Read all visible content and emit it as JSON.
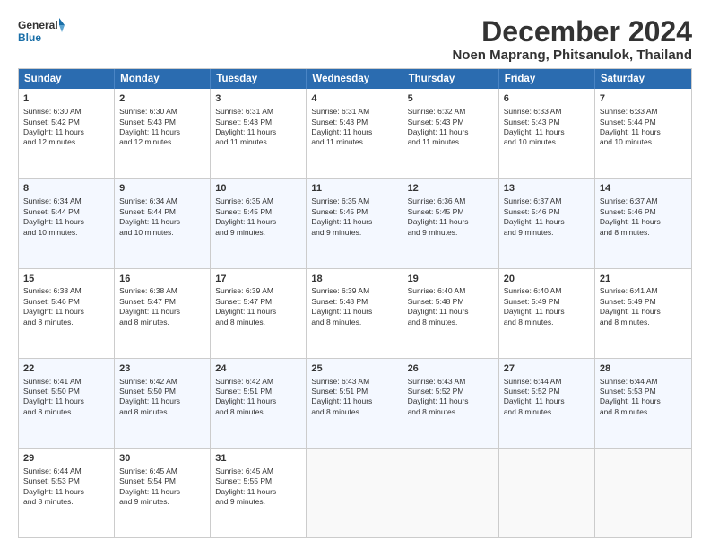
{
  "logo": {
    "line1": "General",
    "line2": "Blue"
  },
  "title": "December 2024",
  "subtitle": "Noen Maprang, Phitsanulok, Thailand",
  "days": [
    "Sunday",
    "Monday",
    "Tuesday",
    "Wednesday",
    "Thursday",
    "Friday",
    "Saturday"
  ],
  "weeks": [
    [
      {
        "num": "1",
        "lines": [
          "Sunrise: 6:30 AM",
          "Sunset: 5:42 PM",
          "Daylight: 11 hours",
          "and 12 minutes."
        ]
      },
      {
        "num": "2",
        "lines": [
          "Sunrise: 6:30 AM",
          "Sunset: 5:43 PM",
          "Daylight: 11 hours",
          "and 12 minutes."
        ]
      },
      {
        "num": "3",
        "lines": [
          "Sunrise: 6:31 AM",
          "Sunset: 5:43 PM",
          "Daylight: 11 hours",
          "and 11 minutes."
        ]
      },
      {
        "num": "4",
        "lines": [
          "Sunrise: 6:31 AM",
          "Sunset: 5:43 PM",
          "Daylight: 11 hours",
          "and 11 minutes."
        ]
      },
      {
        "num": "5",
        "lines": [
          "Sunrise: 6:32 AM",
          "Sunset: 5:43 PM",
          "Daylight: 11 hours",
          "and 11 minutes."
        ]
      },
      {
        "num": "6",
        "lines": [
          "Sunrise: 6:33 AM",
          "Sunset: 5:43 PM",
          "Daylight: 11 hours",
          "and 10 minutes."
        ]
      },
      {
        "num": "7",
        "lines": [
          "Sunrise: 6:33 AM",
          "Sunset: 5:44 PM",
          "Daylight: 11 hours",
          "and 10 minutes."
        ]
      }
    ],
    [
      {
        "num": "8",
        "lines": [
          "Sunrise: 6:34 AM",
          "Sunset: 5:44 PM",
          "Daylight: 11 hours",
          "and 10 minutes."
        ]
      },
      {
        "num": "9",
        "lines": [
          "Sunrise: 6:34 AM",
          "Sunset: 5:44 PM",
          "Daylight: 11 hours",
          "and 10 minutes."
        ]
      },
      {
        "num": "10",
        "lines": [
          "Sunrise: 6:35 AM",
          "Sunset: 5:45 PM",
          "Daylight: 11 hours",
          "and 9 minutes."
        ]
      },
      {
        "num": "11",
        "lines": [
          "Sunrise: 6:35 AM",
          "Sunset: 5:45 PM",
          "Daylight: 11 hours",
          "and 9 minutes."
        ]
      },
      {
        "num": "12",
        "lines": [
          "Sunrise: 6:36 AM",
          "Sunset: 5:45 PM",
          "Daylight: 11 hours",
          "and 9 minutes."
        ]
      },
      {
        "num": "13",
        "lines": [
          "Sunrise: 6:37 AM",
          "Sunset: 5:46 PM",
          "Daylight: 11 hours",
          "and 9 minutes."
        ]
      },
      {
        "num": "14",
        "lines": [
          "Sunrise: 6:37 AM",
          "Sunset: 5:46 PM",
          "Daylight: 11 hours",
          "and 8 minutes."
        ]
      }
    ],
    [
      {
        "num": "15",
        "lines": [
          "Sunrise: 6:38 AM",
          "Sunset: 5:46 PM",
          "Daylight: 11 hours",
          "and 8 minutes."
        ]
      },
      {
        "num": "16",
        "lines": [
          "Sunrise: 6:38 AM",
          "Sunset: 5:47 PM",
          "Daylight: 11 hours",
          "and 8 minutes."
        ]
      },
      {
        "num": "17",
        "lines": [
          "Sunrise: 6:39 AM",
          "Sunset: 5:47 PM",
          "Daylight: 11 hours",
          "and 8 minutes."
        ]
      },
      {
        "num": "18",
        "lines": [
          "Sunrise: 6:39 AM",
          "Sunset: 5:48 PM",
          "Daylight: 11 hours",
          "and 8 minutes."
        ]
      },
      {
        "num": "19",
        "lines": [
          "Sunrise: 6:40 AM",
          "Sunset: 5:48 PM",
          "Daylight: 11 hours",
          "and 8 minutes."
        ]
      },
      {
        "num": "20",
        "lines": [
          "Sunrise: 6:40 AM",
          "Sunset: 5:49 PM",
          "Daylight: 11 hours",
          "and 8 minutes."
        ]
      },
      {
        "num": "21",
        "lines": [
          "Sunrise: 6:41 AM",
          "Sunset: 5:49 PM",
          "Daylight: 11 hours",
          "and 8 minutes."
        ]
      }
    ],
    [
      {
        "num": "22",
        "lines": [
          "Sunrise: 6:41 AM",
          "Sunset: 5:50 PM",
          "Daylight: 11 hours",
          "and 8 minutes."
        ]
      },
      {
        "num": "23",
        "lines": [
          "Sunrise: 6:42 AM",
          "Sunset: 5:50 PM",
          "Daylight: 11 hours",
          "and 8 minutes."
        ]
      },
      {
        "num": "24",
        "lines": [
          "Sunrise: 6:42 AM",
          "Sunset: 5:51 PM",
          "Daylight: 11 hours",
          "and 8 minutes."
        ]
      },
      {
        "num": "25",
        "lines": [
          "Sunrise: 6:43 AM",
          "Sunset: 5:51 PM",
          "Daylight: 11 hours",
          "and 8 minutes."
        ]
      },
      {
        "num": "26",
        "lines": [
          "Sunrise: 6:43 AM",
          "Sunset: 5:52 PM",
          "Daylight: 11 hours",
          "and 8 minutes."
        ]
      },
      {
        "num": "27",
        "lines": [
          "Sunrise: 6:44 AM",
          "Sunset: 5:52 PM",
          "Daylight: 11 hours",
          "and 8 minutes."
        ]
      },
      {
        "num": "28",
        "lines": [
          "Sunrise: 6:44 AM",
          "Sunset: 5:53 PM",
          "Daylight: 11 hours",
          "and 8 minutes."
        ]
      }
    ],
    [
      {
        "num": "29",
        "lines": [
          "Sunrise: 6:44 AM",
          "Sunset: 5:53 PM",
          "Daylight: 11 hours",
          "and 8 minutes."
        ]
      },
      {
        "num": "30",
        "lines": [
          "Sunrise: 6:45 AM",
          "Sunset: 5:54 PM",
          "Daylight: 11 hours",
          "and 9 minutes."
        ]
      },
      {
        "num": "31",
        "lines": [
          "Sunrise: 6:45 AM",
          "Sunset: 5:55 PM",
          "Daylight: 11 hours",
          "and 9 minutes."
        ]
      },
      {
        "num": "",
        "lines": []
      },
      {
        "num": "",
        "lines": []
      },
      {
        "num": "",
        "lines": []
      },
      {
        "num": "",
        "lines": []
      }
    ]
  ]
}
